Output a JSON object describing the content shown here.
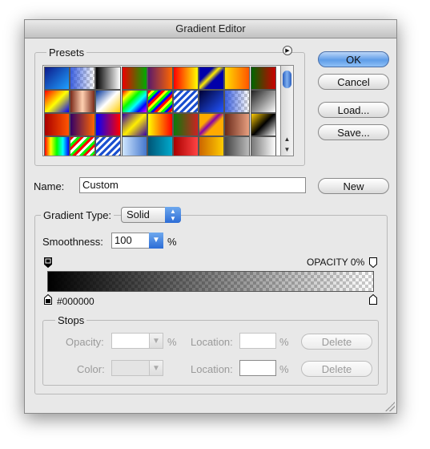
{
  "window": {
    "title": "Gradient Editor"
  },
  "presets": {
    "label": "Presets",
    "swatches": [
      [
        "linear-gradient(135deg,#0d1a8a,#1fa0ff)",
        "checker-blue",
        "linear-gradient(90deg,#000,#fff)",
        "linear-gradient(90deg,#e00,#0a0)",
        "linear-gradient(90deg,#5a1a6a,#ff6600)",
        "linear-gradient(90deg,#ff0000,#ffff00)",
        "linear-gradient(135deg,#0000aa 30%,#ffee00 45%,#0000aa 60%)",
        "linear-gradient(90deg,#ffdd00,#ff5500)",
        "linear-gradient(90deg,#006600,#cc0000)"
      ],
      [
        "linear-gradient(135deg,#ff0000,#ffff00,#0000ff)",
        "linear-gradient(90deg,#7a2a1a,#ffd0b0,#7a2a1a)",
        "linear-gradient(135deg,#003399,#ffffff 50%,#ffcc00)",
        "linear-gradient(135deg,#ff0000,#ffff00,#00ff00,#00ffff,#0000ff,#ff00ff)",
        "repeating-linear-gradient(135deg,#ff0000 0 3px,#ffff00 3px 6px,#00ff00 6px 9px,#0000ff 9px 12px)",
        "repeating-linear-gradient(135deg,#1a4fd0 0 3px,#ffffff 3px 6px)",
        "linear-gradient(135deg,#000033,#2255ff)",
        "checker-blue",
        "linear-gradient(135deg,#222,#ffffff)"
      ],
      [
        "linear-gradient(90deg,#aa0000,#ff5500)",
        "linear-gradient(90deg,#330066,#ff6600)",
        "linear-gradient(90deg,#0000ff,#ff0000)",
        "linear-gradient(135deg,#3300aa,#ffee00,#3300aa)",
        "linear-gradient(90deg,#ffff00,#ff0000)",
        "linear-gradient(90deg,#0a7a0a,#cc2222)",
        "linear-gradient(135deg,#ffaa00 30%,#8800aa 45%,#ffaa00 60%)",
        "linear-gradient(90deg,#6a2a1a,#e8a080)",
        "linear-gradient(135deg,#ffcc00,#000000 50%,#ffffff)"
      ],
      [
        "linear-gradient(90deg,#ff0000,#ffff00,#00ff00,#00ffff,#0000ff)",
        "repeating-linear-gradient(135deg,#ff0000 0 3px,#ffffff 3px 6px,#00ff00 6px 9px)",
        "repeating-linear-gradient(135deg,#1a4fd0 0 3px,#ffffff 3px 6px)",
        "linear-gradient(90deg,#cfe6ff,#4477cc)",
        "linear-gradient(90deg,#005577,#00aacc)",
        "linear-gradient(90deg,#aa0000,#ff4444)",
        "linear-gradient(90deg,#cc6600,#ffcc00)",
        "linear-gradient(90deg,#444,#bbb)",
        "linear-gradient(90deg,#777,#fff)"
      ]
    ]
  },
  "buttons": {
    "ok": "OK",
    "cancel": "Cancel",
    "load": "Load...",
    "save": "Save...",
    "new": "New"
  },
  "name": {
    "label": "Name:",
    "value": "Custom"
  },
  "gradient_type": {
    "label": "Gradient Type:",
    "value": "Solid"
  },
  "smoothness": {
    "label": "Smoothness:",
    "value": "100",
    "unit": "%"
  },
  "opacity_stop_label": "OPACITY 0%",
  "color_stop_label": "#000000",
  "gradient": {
    "start_color": "#000000",
    "start_opacity": 1,
    "end_opacity": 0
  },
  "stops": {
    "label": "Stops",
    "opacity_label": "Opacity:",
    "opacity_unit": "%",
    "location_label": "Location:",
    "location_unit": "%",
    "color_label": "Color:",
    "delete_label": "Delete"
  }
}
